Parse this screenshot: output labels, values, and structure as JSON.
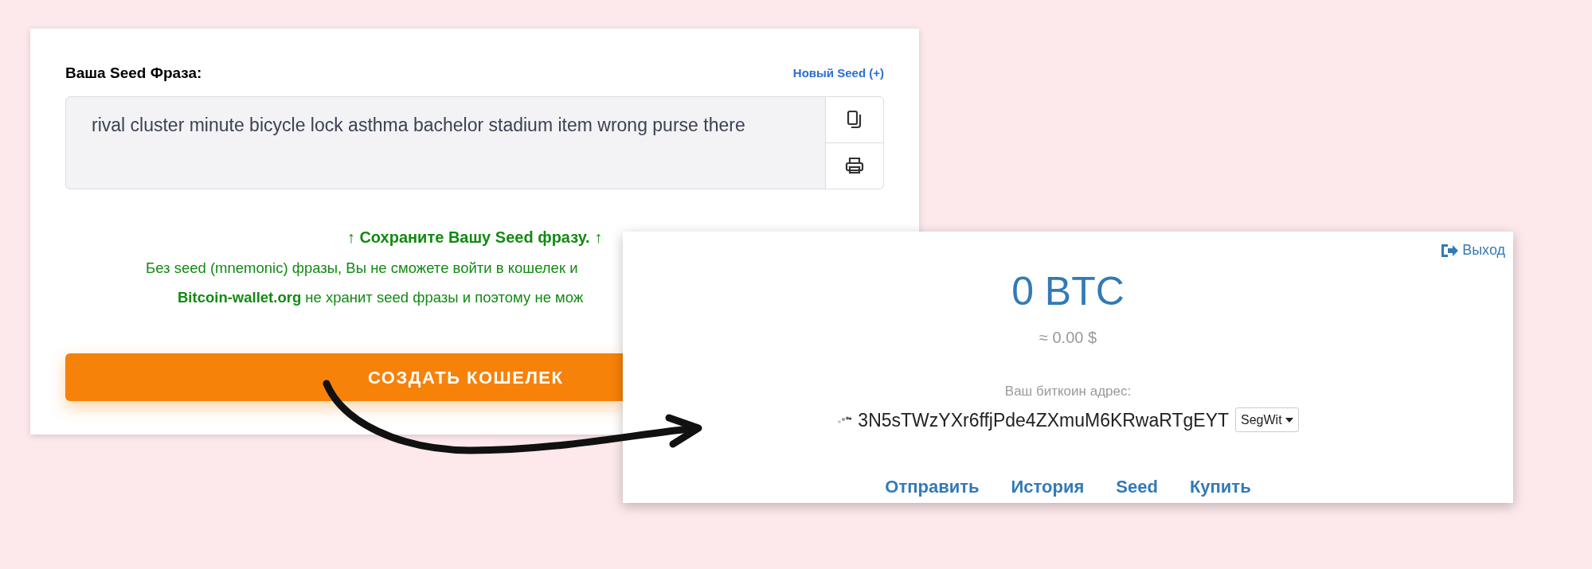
{
  "seed_card": {
    "title": "Ваша Seed Фраза:",
    "new_seed_link": "Новый Seed (+)",
    "seed_phrase": "rival cluster minute bicycle lock asthma bachelor stadium item wrong purse there",
    "notice": {
      "heading": "↑ Сохраните Вашу Seed фразу. ↑",
      "lines": [
        "Без seed (mnemonic) фразы, Вы не сможете войти в кошелек и",
        "**Bitcoin-wallet.org** не хранит seed фразы и поэтому не мож"
      ]
    },
    "create_button": "СОЗДАТЬ КОШЕЛЕК"
  },
  "wallet_card": {
    "logout": "Выход",
    "balance": "0 BTC",
    "fiat": "≈ 0.00 $",
    "address_label": "Ваш биткоин адрес:",
    "address": "3N5sTWzYXr6ffjPde4ZXmuM6KRwaRTgEYT",
    "address_type": "SegWit",
    "nav": [
      "Отправить",
      "История",
      "Seed",
      "Купить"
    ]
  }
}
